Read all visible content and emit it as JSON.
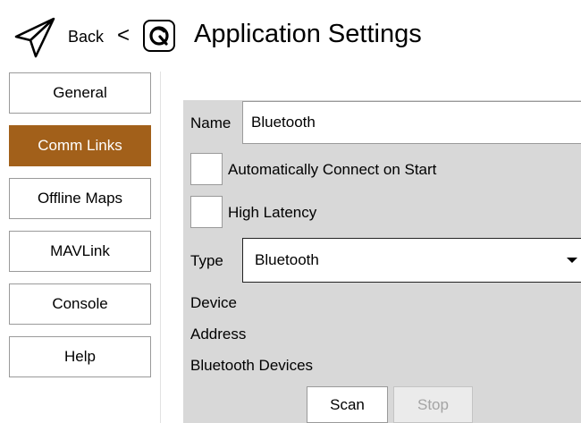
{
  "header": {
    "back_label": "Back",
    "back_chevron": "<",
    "title": "Application Settings",
    "app_icon": "paper-plane-icon",
    "logo_icon": "qgc-logo-icon"
  },
  "sidebar": {
    "items": [
      {
        "label": "General",
        "active": false
      },
      {
        "label": "Comm Links",
        "active": true
      },
      {
        "label": "Offline Maps",
        "active": false
      },
      {
        "label": "MAVLink",
        "active": false
      },
      {
        "label": "Console",
        "active": false
      },
      {
        "label": "Help",
        "active": false
      }
    ]
  },
  "form": {
    "name_label": "Name",
    "name_value": "Bluetooth",
    "auto_connect_label": "Automatically Connect on Start",
    "auto_connect_checked": false,
    "high_latency_label": "High Latency",
    "high_latency_checked": false,
    "type_label": "Type",
    "type_value": "Bluetooth",
    "device_label": "Device",
    "address_label": "Address",
    "bt_devices_label": "Bluetooth Devices",
    "scan_label": "Scan",
    "stop_label": "Stop"
  },
  "colors": {
    "accent": "#a2601a",
    "panel": "#d8d8d8"
  }
}
